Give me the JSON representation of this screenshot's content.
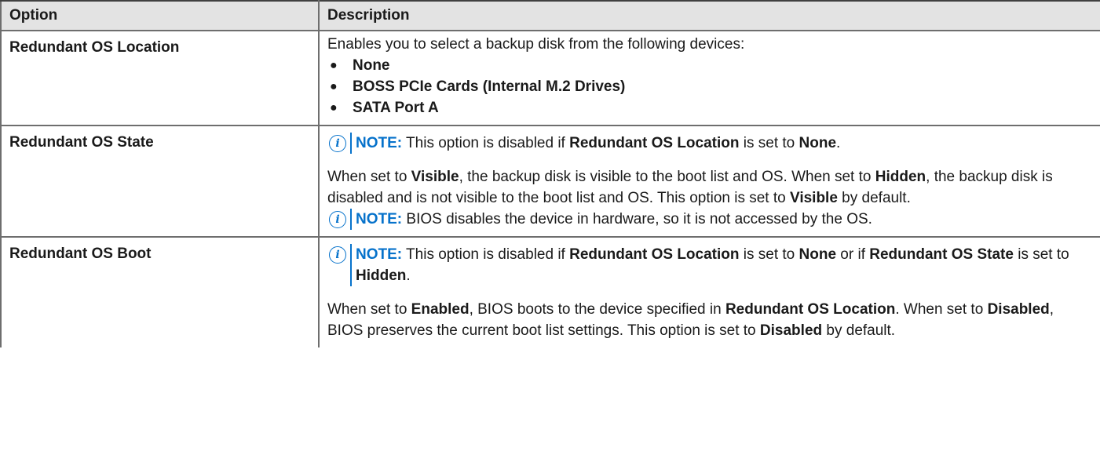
{
  "header": {
    "option": "Option",
    "description": "Description"
  },
  "row1": {
    "option": "Redundant OS Location",
    "intro": "Enables you to select a backup disk from the following devices:",
    "items": [
      "None",
      "BOSS PCIe Cards (Internal M.2 Drives)",
      "SATA Port A"
    ]
  },
  "row2": {
    "option": "Redundant OS State",
    "note_label": "NOTE:",
    "note1": {
      "t1": "This option is disabled if ",
      "b1": "Redundant OS Location",
      "t2": " is set to ",
      "b2": "None",
      "t3": "."
    },
    "para": {
      "t1": "When set to ",
      "b1": "Visible",
      "t2": ", the backup disk is visible to the boot list and OS. When set to ",
      "b2": "Hidden",
      "t3": ", the backup disk is disabled and is not visible to the boot list and OS. This option is set to ",
      "b3": "Visible",
      "t4": " by default."
    },
    "note2": "BIOS disables the device in hardware, so it is not accessed by the OS."
  },
  "row3": {
    "option": "Redundant OS Boot",
    "note_label": "NOTE:",
    "note": {
      "t1": "This option is disabled if ",
      "b1": "Redundant OS Location",
      "t2": " is set to ",
      "b2": "None",
      "t3": " or if ",
      "b3": "Redundant OS State",
      "t4": " is set to ",
      "b4": "Hidden",
      "t5": "."
    },
    "para": {
      "t1": "When set to ",
      "b1": "Enabled",
      "t2": ", BIOS boots to the device specified in ",
      "b2": "Redundant OS Location",
      "t3": ". When set to ",
      "b3": "Disabled",
      "t4": ", BIOS preserves the current boot list settings. This option is set to ",
      "b4": "Disabled",
      "t5": " by default."
    }
  },
  "icons": {
    "note": "info-circle-icon",
    "bullet": "●"
  },
  "colors": {
    "note_accent": "#0672cb",
    "header_bg": "#e3e3e3",
    "border": "#6e6e6e"
  }
}
